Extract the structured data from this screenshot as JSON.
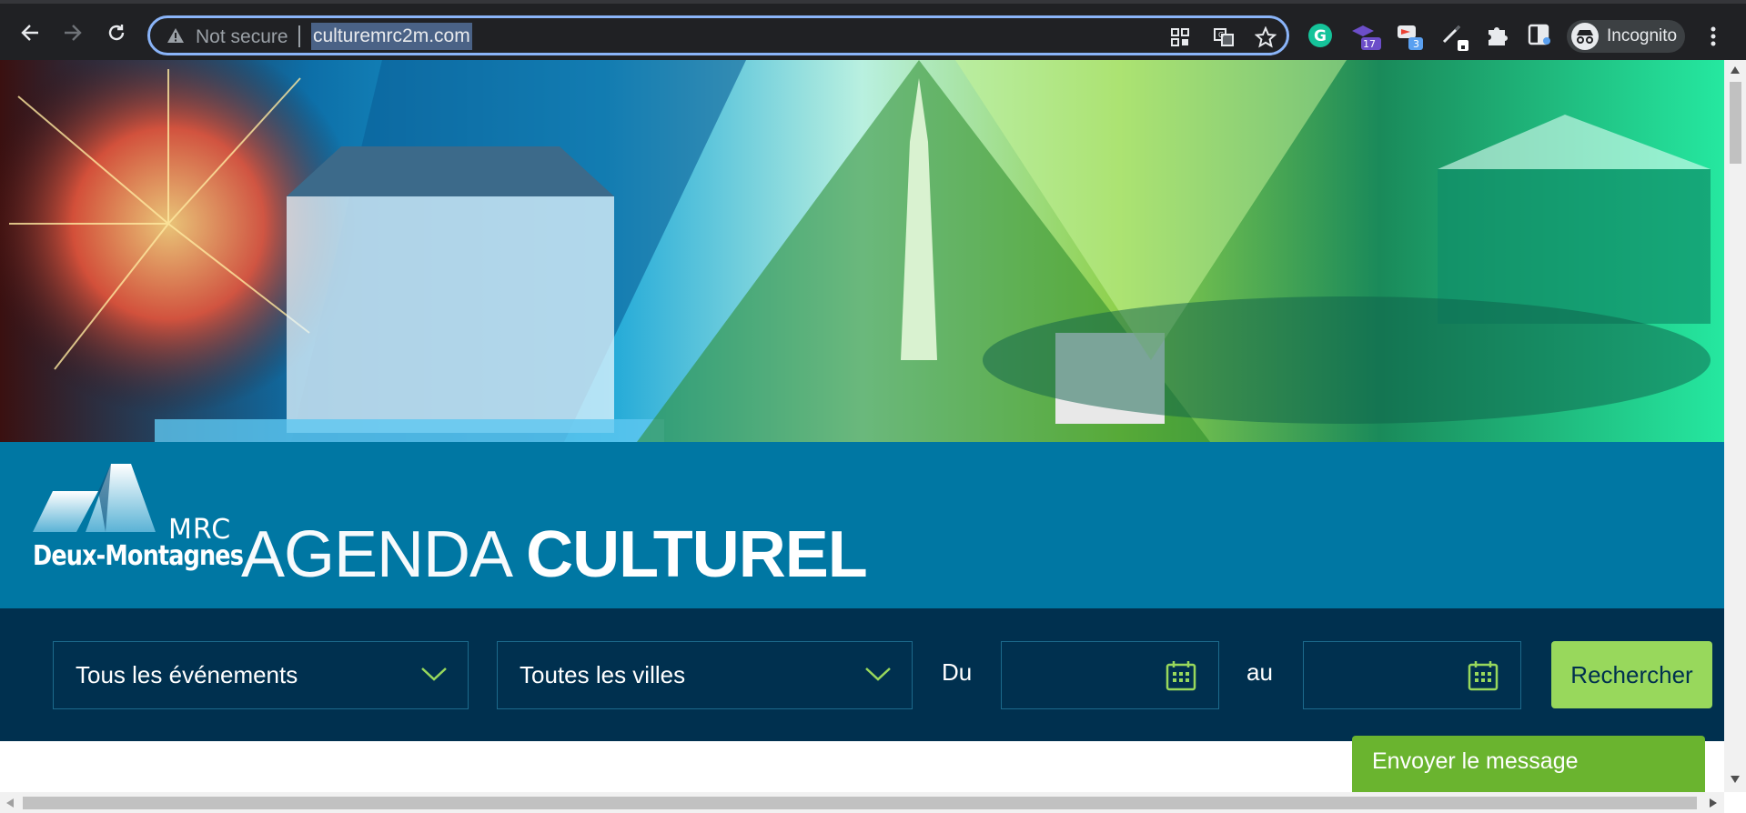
{
  "browser": {
    "security_label": "Not secure",
    "url": "culturemrc2m.com",
    "incognito_label": "Incognito",
    "extensions": [
      {
        "name": "grammarly-icon"
      },
      {
        "name": "mortarboard-extension-icon",
        "badge": "17"
      },
      {
        "name": "cast-extension-icon",
        "badge": "3"
      },
      {
        "name": "pen-extension-icon"
      },
      {
        "name": "puzzle-icon"
      },
      {
        "name": "reading-list-icon"
      }
    ]
  },
  "header": {
    "logo_mrc": "MRC",
    "logo_name": "Deux-Montagnes",
    "title_thin": "AGENDA",
    "title_bold": "CULTUREL"
  },
  "search": {
    "events_select": "Tous les événements",
    "cities_select": "Toutes les villes",
    "from_label": "Du",
    "to_label": "au",
    "submit_label": "Rechercher"
  },
  "chat": {
    "send_label": "Envoyer le message"
  },
  "colors": {
    "title_band": "#0077a3",
    "search_band": "#00304f",
    "accent_green": "#98d85c",
    "chat_green": "#6ab42f"
  }
}
